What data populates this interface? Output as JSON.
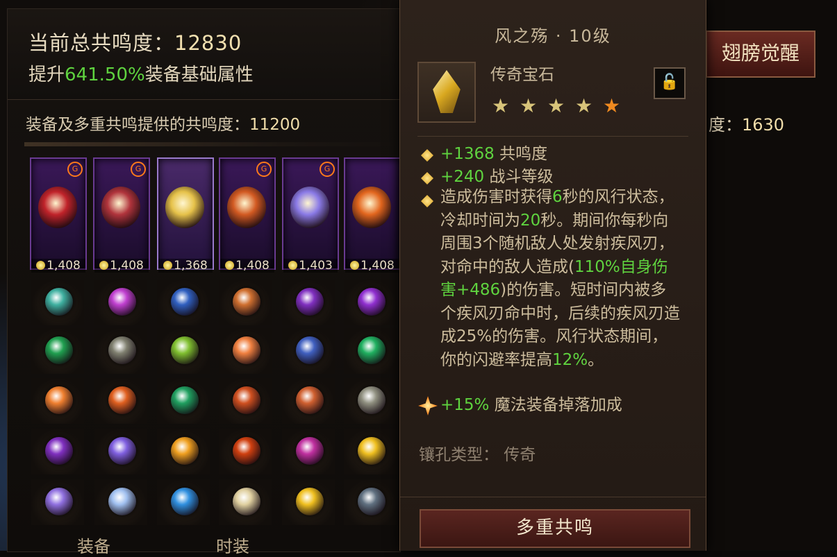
{
  "left_panel": {
    "total_label": "当前总共鸣度：",
    "total_value": "12830",
    "boost_prefix": "提升",
    "boost_percent": "641.50%",
    "boost_suffix": "装备基础属性",
    "sub_label": "装备及多重共鸣提供的共鸣度：",
    "sub_value": "11200",
    "slots": [
      {
        "value": "1,408",
        "color": "#c0232a",
        "badge": "G"
      },
      {
        "value": "1,408",
        "color": "#b0343c",
        "badge": "G"
      },
      {
        "value": "1,368",
        "color": "#e6c24a",
        "badge": ""
      },
      {
        "value": "1,408",
        "color": "#d25a22",
        "badge": "G"
      },
      {
        "value": "1,403",
        "color": "#8a7ae6",
        "badge": "G"
      },
      {
        "value": "1,408",
        "color": "#e2661e",
        "badge": ""
      }
    ],
    "tabs": [
      "装备",
      "时装"
    ]
  },
  "right_peek": {
    "awaken_label": "翅膀觉醒",
    "sub_label": "度：",
    "sub_value": "1630"
  },
  "tooltip": {
    "title": "风之殇 · 10级",
    "gem_type": "传奇宝石",
    "star_count": 5,
    "stats": [
      {
        "value": "+1368",
        "label": " 共鸣度"
      },
      {
        "value": "+240",
        "label": " 战斗等级"
      }
    ],
    "desc_parts": [
      "造成伤害时获得",
      "6",
      "秒的风行状态，冷却时间为",
      "20",
      "秒。期间你每秒向周围3个随机敌人处发射疾风刃，对命中的敌人造成(",
      "110%自身伤害+486",
      ")的伤害。短时间内被多个疾风刃命中时，后续的疾风刃造成25%的伤害。风行状态期间，你的闪避率提高",
      "12%",
      "。"
    ],
    "bonus_value": "+15%",
    "bonus_label": " 魔法装备掉落加成",
    "socket_text": "镶孔类型：  传奇",
    "multi_button": "多重共鸣"
  },
  "colors": {
    "highlight_green": "#5fd33f",
    "star_gold": "#d8c47a",
    "star_orange": "#f08a20"
  },
  "gem_grid": [
    [
      "#3fb0a0",
      "#c040d0",
      "#3060c0",
      "#d07030",
      "#8030c0",
      "#9030d0"
    ],
    [
      "#20a050",
      "#808070",
      "#80c030",
      "#f08040",
      "#4060c0",
      "#20b060"
    ],
    [
      "#f08030",
      "#e06020",
      "#20a060",
      "#d05020",
      "#d06030",
      "#909080"
    ],
    [
      "#8030c0",
      "#8060e0",
      "#f0a020",
      "#d04010",
      "#c030a0",
      "#f0c020"
    ],
    [
      "#9070e0",
      "#a0c0f0",
      "#3090e0",
      "#e0d0a0",
      "#f0c020",
      "#607080"
    ]
  ]
}
